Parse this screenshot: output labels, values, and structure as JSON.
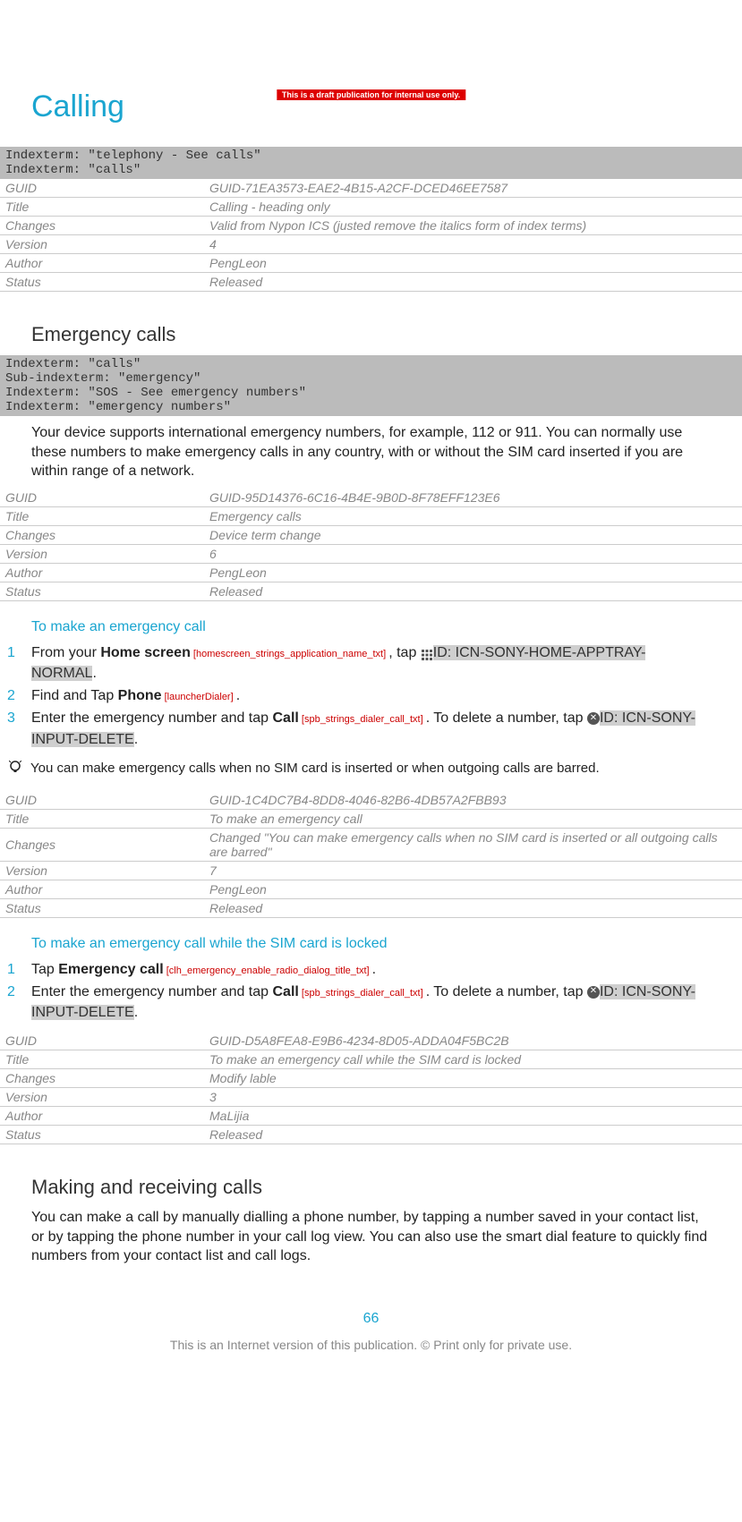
{
  "banner": "This is a draft publication for internal use only.",
  "title": "Calling",
  "indexterm1": {
    "line1": "Indexterm: \"telephony - See calls\"",
    "line2": "Indexterm: \"calls\""
  },
  "meta1": {
    "guid_l": "GUID",
    "guid_v": "GUID-71EA3573-EAE2-4B15-A2CF-DCED46EE7587",
    "title_l": "Title",
    "title_v": "Calling - heading only",
    "changes_l": "Changes",
    "changes_v": "Valid from Nypon ICS (justed remove the italics form of index terms)",
    "version_l": "Version",
    "version_v": "4",
    "author_l": "Author",
    "author_v": "PengLeon",
    "status_l": "Status",
    "status_v": "Released"
  },
  "emergency": {
    "heading": "Emergency calls",
    "idx1": "Indexterm: \"calls\"",
    "idx2": "Sub-indexterm: \"emergency\"",
    "idx3": "Indexterm: \"SOS - See emergency numbers\"",
    "idx4": "Indexterm: \"emergency numbers\"",
    "body": "Your device supports international emergency numbers, for example, 112 or 911. You can normally use these numbers to make emergency calls in any country, with or without the SIM card inserted if you are within range of a network."
  },
  "meta2": {
    "guid_l": "GUID",
    "guid_v": "GUID-95D14376-6C16-4B4E-9B0D-8F78EFF123E6",
    "title_l": "Title",
    "title_v": "Emergency calls",
    "changes_l": "Changes",
    "changes_v": "Device term change",
    "version_l": "Version",
    "version_v": "6",
    "author_l": "Author",
    "author_v": "PengLeon",
    "status_l": "Status",
    "status_v": "Released"
  },
  "proc1": {
    "heading": "To make an emergency call",
    "s1_a": "From your ",
    "s1_home": "Home screen",
    "s1_tag1": " [homescreen_strings_application_name_txt] ",
    "s1_b": ", tap ",
    "s1_imgid": "ID: ICN-SONY-HOME-APPTRAY-NORMAL",
    "s1_c": ".",
    "s2_a": "Find and Tap ",
    "s2_phone": "Phone",
    "s2_tag": " [launcherDialer] ",
    "s2_b": ".",
    "s3_a": "Enter the emergency number and tap ",
    "s3_call": "Call",
    "s3_tag": " [spb_strings_dialer_call_txt] ",
    "s3_b": ". To delete a number, tap ",
    "s3_imgid": "ID: ICN-SONY-INPUT-DELETE",
    "s3_c": ".",
    "tip": "You can make emergency calls when no SIM card is inserted or when outgoing calls are barred."
  },
  "meta3": {
    "guid_l": "GUID",
    "guid_v": "GUID-1C4DC7B4-8DD8-4046-82B6-4DB57A2FBB93",
    "title_l": "Title",
    "title_v": "To make an emergency call",
    "changes_l": "Changes",
    "changes_v": "Changed \"You can make emergency calls when no SIM card is inserted or all outgoing calls are barred\"",
    "version_l": "Version",
    "version_v": "7",
    "author_l": "Author",
    "author_v": "PengLeon",
    "status_l": "Status",
    "status_v": "Released"
  },
  "proc2": {
    "heading": "To make an emergency call while the SIM card is locked",
    "s1_a": "Tap ",
    "s1_em": "Emergency call",
    "s1_tag": " [clh_emergency_enable_radio_dialog_title_txt] ",
    "s1_b": ".",
    "s2_a": "Enter the emergency number and tap ",
    "s2_call": "Call",
    "s2_tag": " [spb_strings_dialer_call_txt] ",
    "s2_b": ". To delete a number, tap ",
    "s2_imgid": "ID: ICN-SONY-INPUT-DELETE",
    "s2_c": "."
  },
  "meta4": {
    "guid_l": "GUID",
    "guid_v": "GUID-D5A8FEA8-E9B6-4234-8D05-ADDA04F5BC2B",
    "title_l": "Title",
    "title_v": "To make an emergency call while the SIM card is locked",
    "changes_l": "Changes",
    "changes_v": "Modify lable",
    "version_l": "Version",
    "version_v": "3",
    "author_l": "Author",
    "author_v": "MaLijia",
    "status_l": "Status",
    "status_v": "Released"
  },
  "making": {
    "heading": "Making and receiving calls",
    "body": "You can make a call by manually dialling a phone number, by tapping a number saved in your contact list, or by tapping the phone number in your call log view. You can also use the smart dial feature to quickly find numbers from your contact list and call logs."
  },
  "page_num": "66",
  "footer": "This is an Internet version of this publication. © Print only for private use."
}
